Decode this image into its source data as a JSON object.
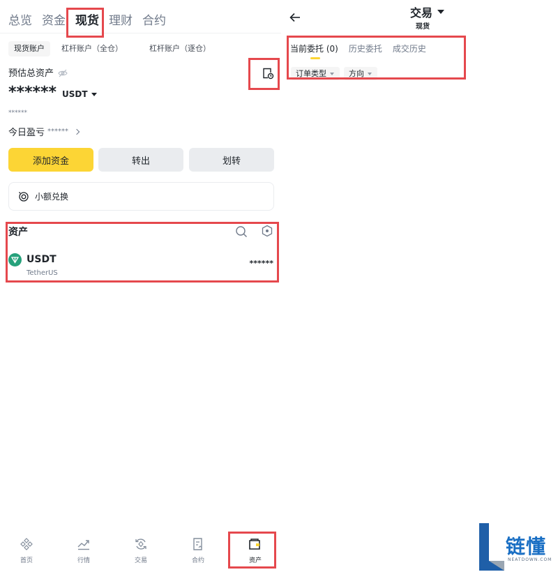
{
  "left": {
    "top_tabs": [
      "总览",
      "资金",
      "现货",
      "理财",
      "合约"
    ],
    "active_top_tab": "现货",
    "sub_tabs": [
      "现货账户",
      "杠杆账户（全仓）",
      "杠杆账户（逐仓）"
    ],
    "estimated_label": "预估总资产",
    "balance": "******",
    "currency": "USDT",
    "sub_balance": "******",
    "pnl_label": "今日盈亏",
    "pnl_value": "******",
    "buttons": {
      "add": "添加资金",
      "withdraw": "转出",
      "transfer": "划转"
    },
    "convert_label": "小额兑换",
    "assets_title": "资产",
    "asset": {
      "symbol": "USDT",
      "name": "TetherUS",
      "balance": "******"
    },
    "bottom_nav": [
      "首页",
      "行情",
      "交易",
      "合约",
      "资产"
    ],
    "active_nav": "资产"
  },
  "right": {
    "title": "交易",
    "subtitle": "现货",
    "tabs": [
      "当前委托 (0)",
      "历史委托",
      "成交历史"
    ],
    "active_tab": "当前委托 (0)",
    "filters": [
      "订单类型",
      "方向"
    ]
  },
  "watermark": {
    "text": "链懂",
    "url": "NEATDOWN.COM"
  },
  "colors": {
    "accent": "#fcd535",
    "highlight": "#e5484d",
    "usdt": "#26a17b",
    "watermark": "#1a6fc4"
  }
}
